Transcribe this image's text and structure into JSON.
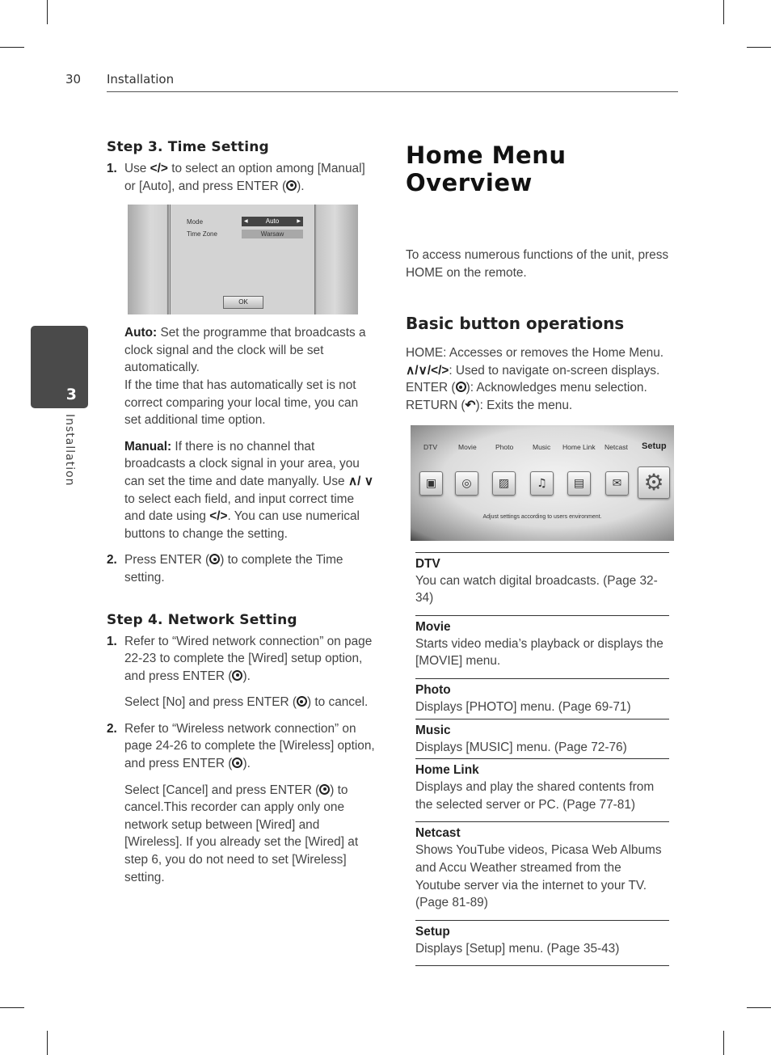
{
  "header": {
    "page_number": "30",
    "section": "Installation"
  },
  "side_tab": {
    "chapter_number": "3",
    "label": "Installation"
  },
  "left": {
    "step3": {
      "heading": "Step 3. Time Setting",
      "item1": {
        "num": "1.",
        "text_a": "Use ",
        "arrows": "</>",
        "text_b": " to select an option among [Manual] or [Auto], and press ENTER (",
        "text_c": ")."
      },
      "screenshot": {
        "mode_label": "Mode",
        "mode_value": "Auto",
        "timezone_label": "Time Zone",
        "timezone_value": "Warsaw",
        "ok_button": "OK"
      },
      "auto": {
        "label": "Auto:",
        "text": " Set the programme that broadcasts a clock signal and the clock will be set automatically.",
        "text2": "If the time that has automatically set is not correct comparing your local time, you can set additional time option."
      },
      "manual": {
        "label": "Manual:",
        "text_a": " If there is no channel that broadcasts a clock signal in your area, you can set the time and date manyally. Use ",
        "updown": "∧/ ∨",
        "text_b": " to select each field, and input correct time and date using ",
        "arrows": "</>",
        "text_c": ". You can use numerical buttons to change the setting."
      },
      "item2": {
        "num": "2.",
        "text_a": "Press ENTER (",
        "text_b": ") to complete the Time setting."
      }
    },
    "step4": {
      "heading": "Step 4. Network Setting",
      "item1": {
        "num": "1.",
        "text_a": "Refer to “Wired network connection” on page 22-23 to complete the [Wired] setup option, and press ENTER (",
        "text_b": ")."
      },
      "item1_note": {
        "text_a": "Select [No] and press ENTER (",
        "text_b": ") to cancel."
      },
      "item2": {
        "num": "2.",
        "text_a": "Refer to “Wireless network connection” on page 24-26 to complete the [Wireless] option, and press ENTER (",
        "text_b": ")."
      },
      "item2_note": {
        "text_a": "Select [Cancel] and press ENTER (",
        "text_b": ") to cancel.This recorder can apply only one network setup between [Wired] and [Wireless]. If you already set the [Wired] at step 6, you do not need to set [Wireless] setting."
      }
    }
  },
  "right": {
    "title": "Home Menu Overview",
    "intro": "To access numerous functions of the unit, press HOME on the remote.",
    "basic": {
      "heading": "Basic button operations",
      "line1": "HOME: Accesses or removes the Home Menu.",
      "line2_glyphs": "∧/∨/</>",
      "line2_text": ": Used to navigate on-screen displays.",
      "line3_a": "ENTER (",
      "line3_b": "): Acknowledges menu selection.",
      "line4_a": "RETURN (",
      "return_icon": "↶",
      "line4_b": "): Exits the menu."
    },
    "home_screen": {
      "menu": [
        "DTV",
        "Movie",
        "Photo",
        "Music",
        "Home Link",
        "Netcast",
        "Setup"
      ],
      "selected": "Setup",
      "icons": [
        "tv-icon",
        "film-reel-icon",
        "photo-icon",
        "music-note-icon",
        "folder-icon",
        "netcast-icon",
        "gear-icon"
      ],
      "icon_glyphs": [
        "▣",
        "◎",
        "▨",
        "♫",
        "▤",
        "✉",
        "⚙"
      ],
      "hint": "Adjust settings according to users environment."
    },
    "definitions": [
      {
        "term": "DTV",
        "desc": "You can watch digital broadcasts. (Page 32-34)"
      },
      {
        "term": "Movie",
        "desc": "Starts video media’s playback or displays the [MOVIE] menu."
      },
      {
        "term": "Photo",
        "desc": "Displays [PHOTO] menu. (Page 69-71)"
      },
      {
        "term": "Music",
        "desc": "Displays [MUSIC] menu. (Page 72-76)"
      },
      {
        "term": "Home Link",
        "desc": "Displays and play the shared contents from the selected server or PC. (Page 77-81)"
      },
      {
        "term": "Netcast",
        "desc": "Shows YouTube videos, Picasa Web Albums and Accu Weather streamed from the Youtube server via the internet to your TV. (Page 81-89)"
      },
      {
        "term": "Setup",
        "desc": "Displays [Setup] menu. (Page 35-43)"
      }
    ]
  }
}
